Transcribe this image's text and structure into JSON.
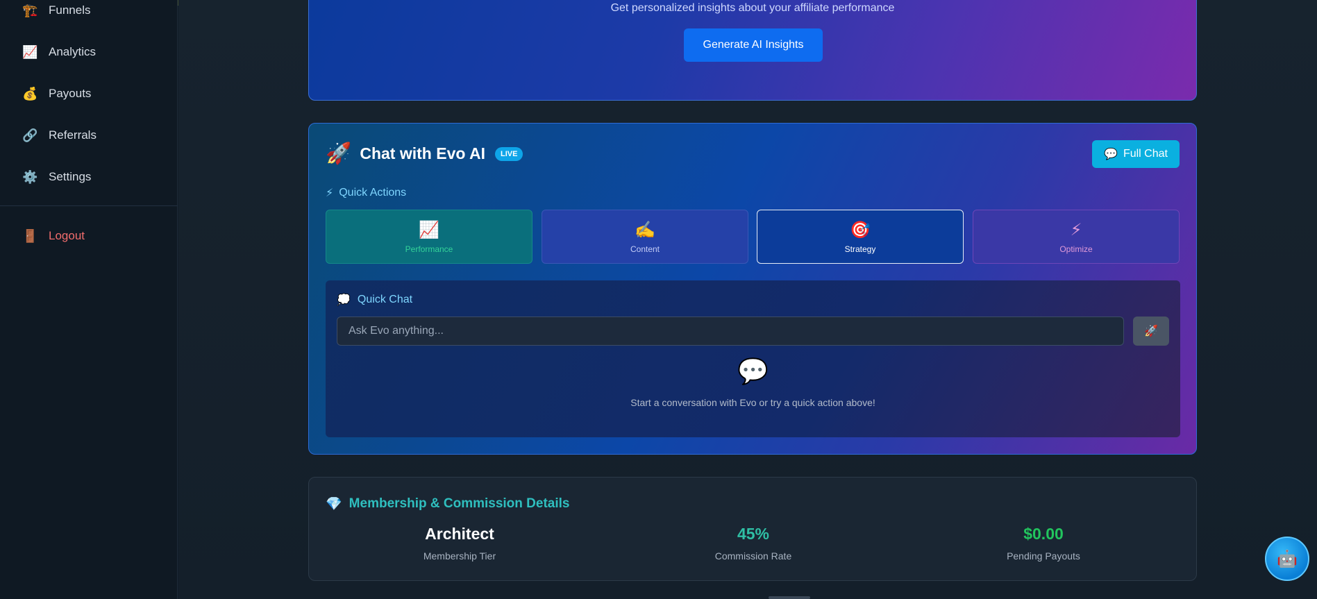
{
  "sidebar": {
    "items": [
      {
        "icon": "🏗️",
        "icon_name": "funnel-icon",
        "label": "Funnels"
      },
      {
        "icon": "📈",
        "icon_name": "chart-icon",
        "label": "Analytics"
      },
      {
        "icon": "💰",
        "icon_name": "money-bag-icon",
        "label": "Payouts"
      },
      {
        "icon": "🔗",
        "icon_name": "link-icon",
        "label": "Referrals"
      },
      {
        "icon": "⚙️",
        "icon_name": "gear-icon",
        "label": "Settings"
      }
    ],
    "logout": {
      "icon": "🚪",
      "icon_name": "door-icon",
      "label": "Logout"
    }
  },
  "insights": {
    "subtitle": "Get personalized insights about your affiliate performance",
    "button_label": "Generate AI Insights"
  },
  "chat": {
    "icon": "🚀",
    "title": "Chat with Evo AI",
    "badge": "LIVE",
    "full_chat_icon": "💬",
    "full_chat_label": "Full Chat",
    "quick_actions_icon": "⚡",
    "quick_actions_label": "Quick Actions",
    "actions": [
      {
        "icon": "📈",
        "label": "Performance"
      },
      {
        "icon": "✍️",
        "label": "Content"
      },
      {
        "icon": "🎯",
        "label": "Strategy"
      },
      {
        "icon": "⚡",
        "label": "Optimize"
      }
    ],
    "quick_chat_icon": "💭",
    "quick_chat_label": "Quick Chat",
    "input_placeholder": "Ask Evo anything...",
    "send_icon": "🚀",
    "empty_icon": "💬",
    "empty_text": "Start a conversation with Evo or try a quick action above!"
  },
  "membership": {
    "icon": "💎",
    "title": "Membership & Commission Details",
    "stats": [
      {
        "value": "Architect",
        "label": "Membership Tier"
      },
      {
        "value": "45%",
        "label": "Commission Rate"
      },
      {
        "value": "$0.00",
        "label": "Pending Payouts"
      }
    ]
  },
  "fab_icon": "🤖",
  "colors": {
    "accent": "#0e6cf0",
    "live_badge": "#0ea5e9",
    "logout": "#f26d6d",
    "commission": "#2fbfa5",
    "payouts": "#22c55e"
  }
}
